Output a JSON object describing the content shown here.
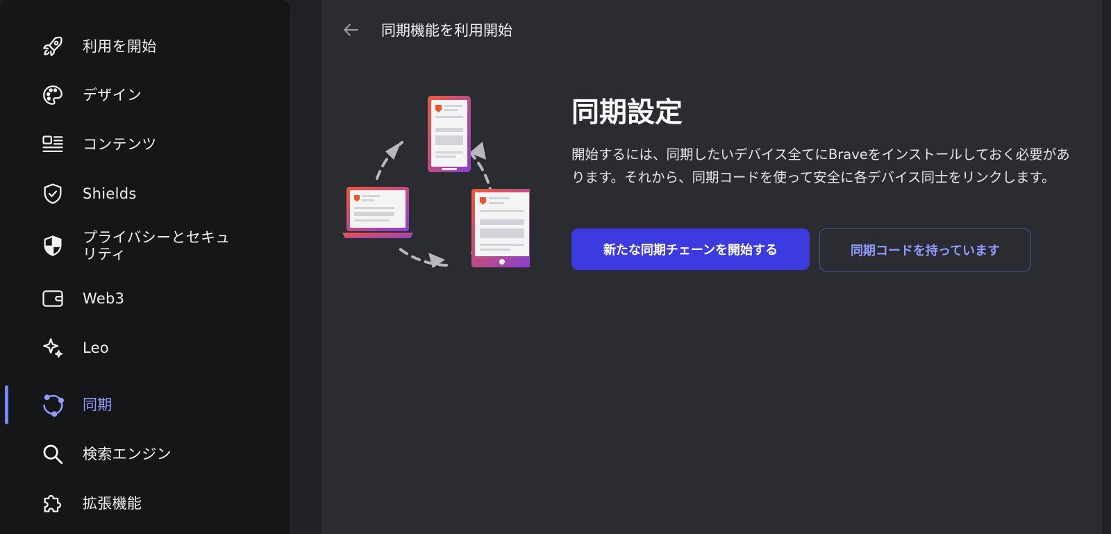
{
  "sidebar": {
    "items": [
      {
        "label": "利用を開始",
        "icon": "rocket-icon"
      },
      {
        "label": "デザイン",
        "icon": "palette-icon"
      },
      {
        "label": "コンテンツ",
        "icon": "content-icon"
      },
      {
        "label": "Shields",
        "icon": "shield-check-icon"
      },
      {
        "label": "プライバシーとセキュリティ",
        "icon": "privacy-shield-icon"
      },
      {
        "label": "Web3",
        "icon": "wallet-icon"
      },
      {
        "label": "Leo",
        "icon": "sparkle-icon"
      },
      {
        "label": "同期",
        "icon": "sync-icon",
        "active": true
      },
      {
        "label": "検索エンジン",
        "icon": "search-icon"
      },
      {
        "label": "拡張機能",
        "icon": "puzzle-icon"
      }
    ],
    "privacy_line1": "プライバシーとセキュ",
    "privacy_line2": "リティ"
  },
  "header": {
    "title": "同期機能を利用開始",
    "back_icon": "arrow-left-icon"
  },
  "main": {
    "heading": "同期設定",
    "description": "開始するには、同期したいデバイス全てにBraveをインストールしておく必要があります。それから、同期コードを使って安全に各デバイス同士をリンクします。",
    "primary_button": "新たな同期チェーンを開始する",
    "secondary_button": "同期コードを持っています"
  },
  "colors": {
    "accent": "#7b85f5",
    "primary_button": "#3c3be0",
    "sidebar_bg": "#151618",
    "main_bg": "#2b2c31"
  }
}
